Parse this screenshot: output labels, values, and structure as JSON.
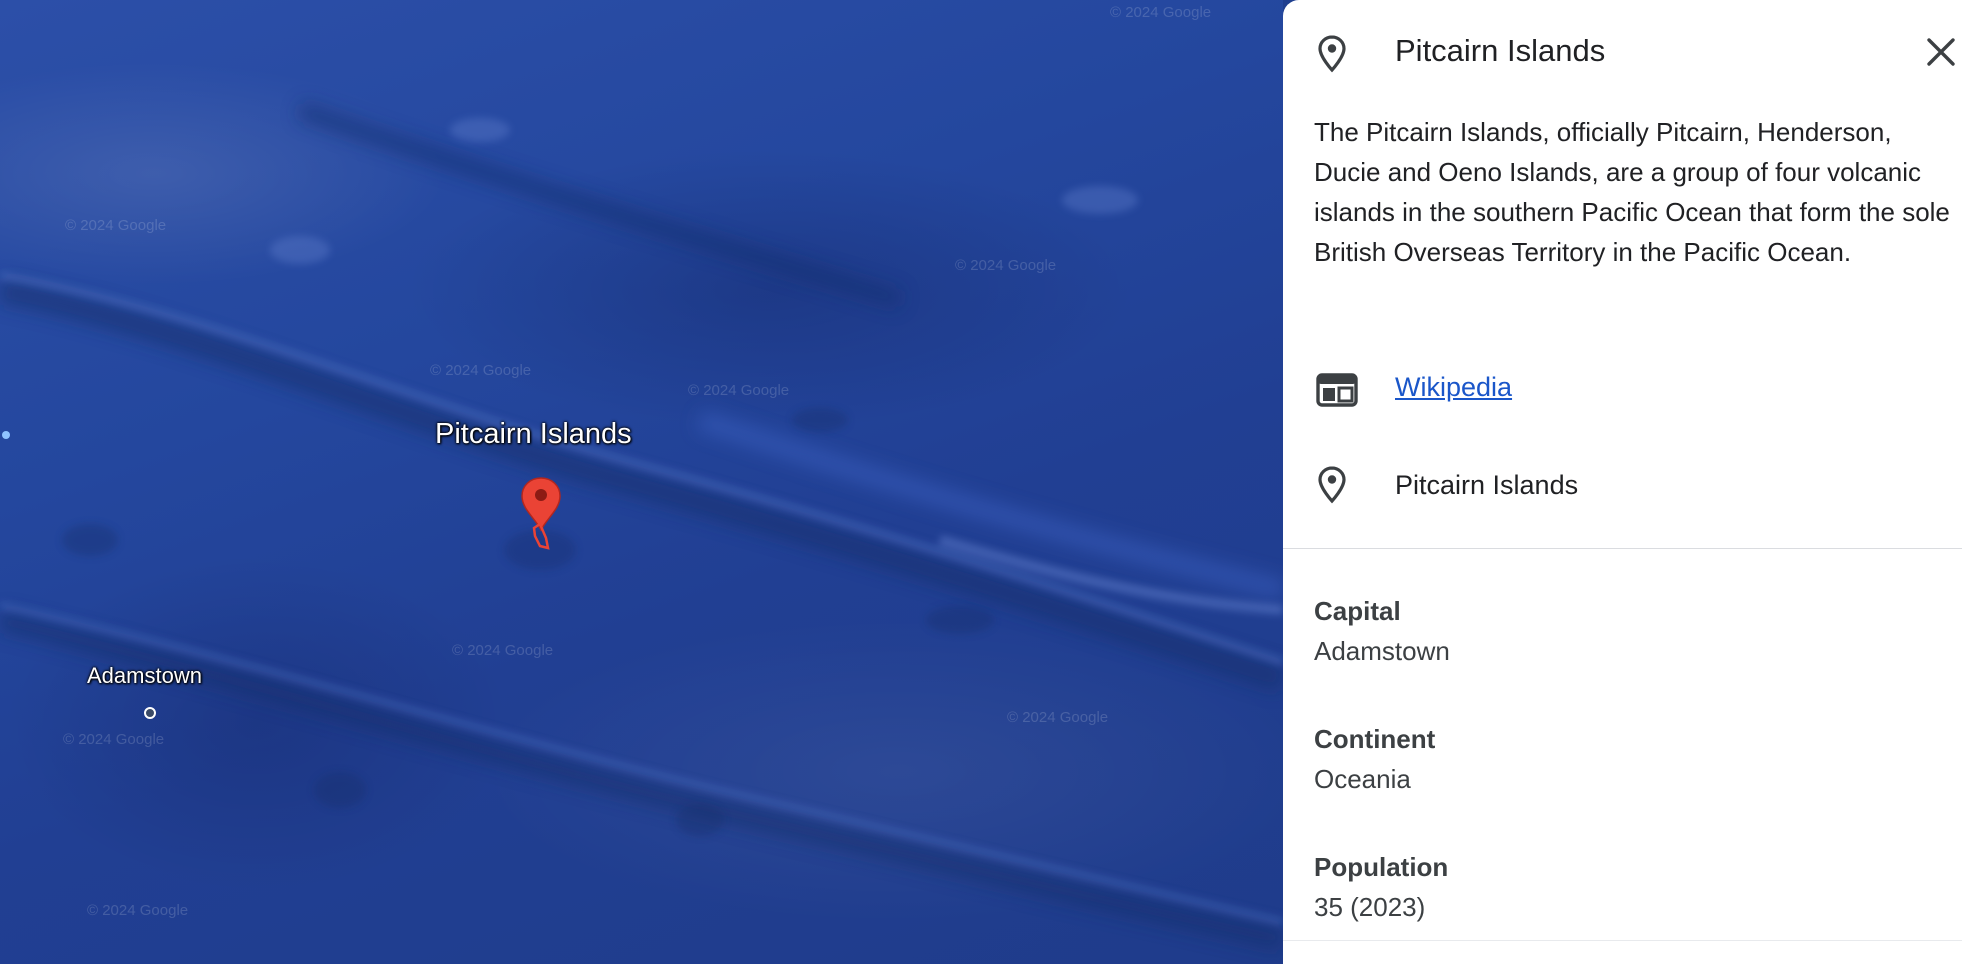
{
  "map": {
    "watermark_text": "© 2024 Google",
    "labels": {
      "pitcairn": "Pitcairn Islands",
      "adamstown": "Adamstown"
    },
    "marker_color": "#ea4335",
    "ocean_color": "#24479e"
  },
  "panel": {
    "title": "Pitcairn Islands",
    "title_icon": "location-pin-icon",
    "close_icon": "close-icon",
    "description": "The Pitcairn Islands, officially Pitcairn, Henderson, Ducie and Oeno Islands, are a group of four volcanic islands in the southern Pacific Ocean that form the sole British Overseas Territory in the Pacific Ocean.",
    "wikipedia": {
      "label": "Wikipedia",
      "icon": "web-page-icon"
    },
    "place": {
      "label": "Pitcairn Islands",
      "icon": "location-pin-icon"
    },
    "facts": [
      {
        "label": "Capital",
        "value": "Adamstown"
      },
      {
        "label": "Continent",
        "value": "Oceania"
      },
      {
        "label": "Population",
        "value": "35 (2023)"
      }
    ],
    "link_color": "#1a56c9"
  }
}
